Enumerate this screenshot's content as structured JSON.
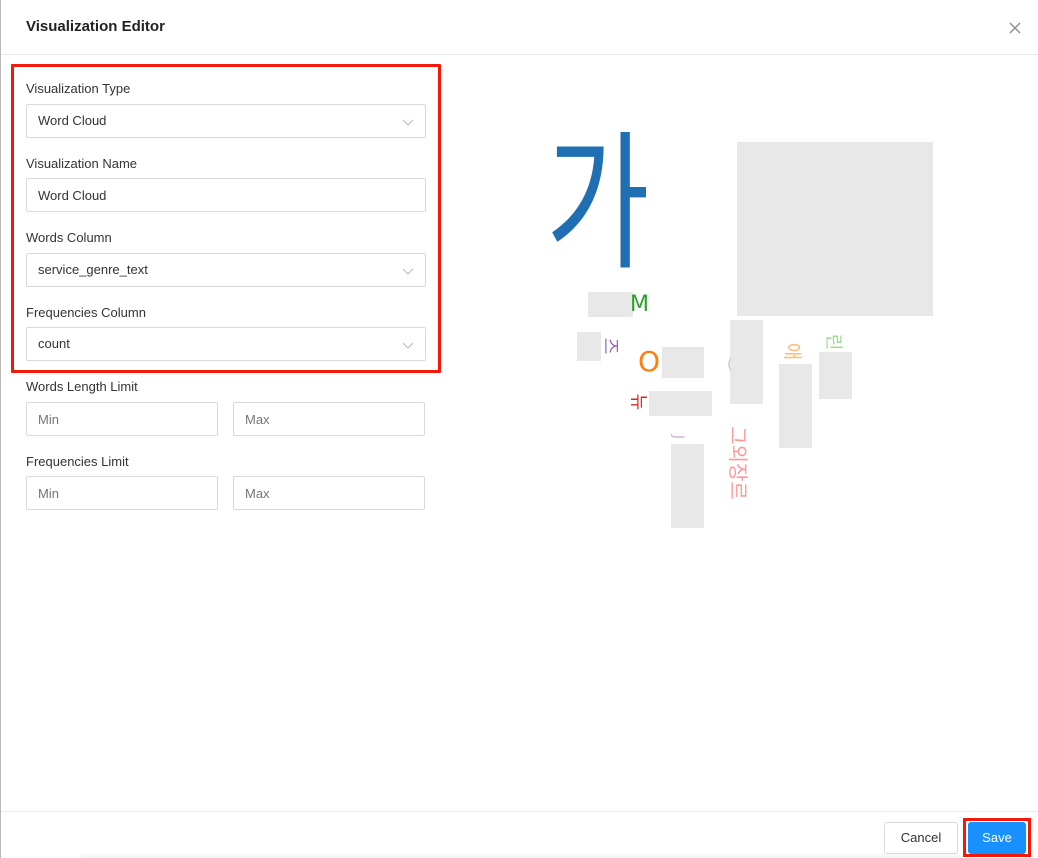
{
  "dialog": {
    "title": "Visualization Editor",
    "close_icon": "close-icon"
  },
  "form": {
    "visualization_type": {
      "label": "Visualization Type",
      "value": "Word Cloud"
    },
    "visualization_name": {
      "label": "Visualization Name",
      "value": "Word Cloud"
    },
    "words_column": {
      "label": "Words Column",
      "value": "service_genre_text"
    },
    "frequencies_column": {
      "label": "Frequencies Column",
      "value": "count"
    },
    "words_length_limit": {
      "label": "Words Length Limit",
      "min_placeholder": "Min",
      "max_placeholder": "Max"
    },
    "frequencies_limit": {
      "label": "Frequencies Limit",
      "min_placeholder": "Min",
      "max_placeholder": "Max"
    }
  },
  "preview": {
    "words": [
      {
        "text": "가",
        "color": "#1f6fb2"
      },
      {
        "text": "M",
        "color": "#2ca02c"
      },
      {
        "text": "즈",
        "color": "#9467bd"
      },
      {
        "text": "O",
        "color": "#ff7f0e"
      },
      {
        "text": "뉴",
        "color": "#d62728"
      },
      {
        "text": "애",
        "color": "#ffbb78"
      },
      {
        "text": "린",
        "color": "#98df8a"
      },
      {
        "text": "그외장르",
        "color": "#ff9896"
      },
      {
        "text": "J",
        "color": "#c5b0d5"
      },
      {
        "text": "(",
        "color": "#c7c7c7"
      }
    ]
  },
  "footer": {
    "cancel_label": "Cancel",
    "save_label": "Save"
  },
  "colors": {
    "primary": "#1890ff",
    "highlight": "#f2190b",
    "border": "#d9d9d9"
  }
}
